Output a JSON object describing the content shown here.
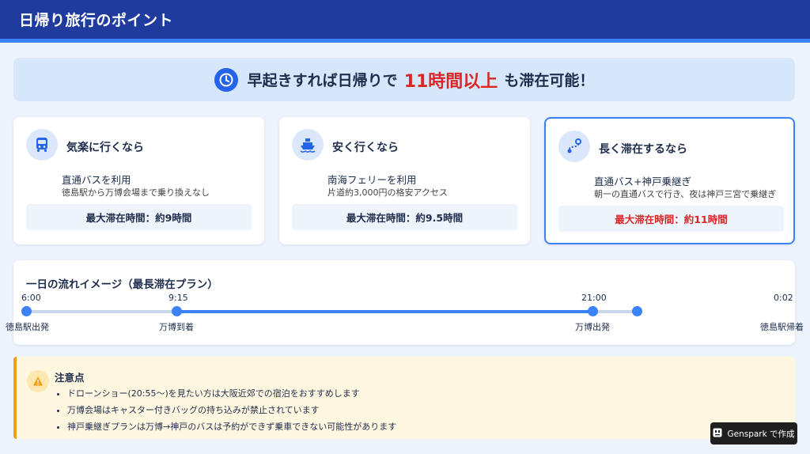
{
  "header": {
    "title": "日帰り旅行のポイント"
  },
  "banner": {
    "pre": "早起きすれば日帰りで",
    "highlight": "11時間以上",
    "post": "も滞在可能！",
    "icon": "clock-icon"
  },
  "cards": [
    {
      "icon": "bus-icon",
      "title": "気楽に行くなら",
      "line1": "直通バスを利用",
      "line2": "徳島駅から万博会場まで乗り換えなし",
      "stay": "最大滞在時間：約9時間"
    },
    {
      "icon": "ferry-icon",
      "title": "安く行くなら",
      "line1": "南海フェリーを利用",
      "line2": "片道約3,000円の格安アクセス",
      "stay": "最大滞在時間：約9.5時間"
    },
    {
      "icon": "route-icon",
      "title": "長く滞在するなら",
      "line1": "直通バス+神戸乗継ぎ",
      "line2": "朝一の直通バスで行き、夜は神戸三宮で乗継ぎ",
      "stay": "最大滞在時間：約11時間"
    }
  ],
  "timeline": {
    "title": "一日の流れイメージ（最長滞在プラン）",
    "points": [
      {
        "time": "6:00",
        "label": "徳島駅出発"
      },
      {
        "time": "9:15",
        "label": "万博到着"
      },
      {
        "time": "21:00",
        "label": "万博出発"
      },
      {
        "time": "0:02",
        "label": "徳島駅帰着"
      }
    ]
  },
  "notice": {
    "title": "注意点",
    "items": [
      "ドローンショー(20:55〜)を見たい方は大阪近郊での宿泊をおすすめします",
      "万博会場はキャスター付きバッグの持ち込みが禁止されています",
      "神戸乗継ぎプランは万博→神戸のバスは予約ができず乗車できない可能性があります"
    ]
  },
  "badge": {
    "label": "Genspark で作成"
  },
  "colors": {
    "header": "#1f3b9e",
    "accent": "#3b82f6",
    "highlight": "#dc2626",
    "warning": "#f59e0b"
  }
}
